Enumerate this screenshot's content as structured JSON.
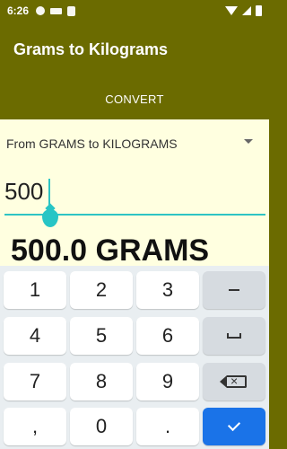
{
  "status_bar": {
    "time": "6:26"
  },
  "app_bar": {
    "title": "Grams to Kilograms"
  },
  "actions": {
    "convert_label": "CONVERT"
  },
  "spinner": {
    "selected": "From GRAMS to KILOGRAMS"
  },
  "input": {
    "value": "500"
  },
  "result": {
    "text": "500.0 GRAMS"
  },
  "keyboard": {
    "rows": [
      [
        "1",
        "2",
        "3",
        "−"
      ],
      [
        "4",
        "5",
        "6",
        "space"
      ],
      [
        "7",
        "8",
        "9",
        "backspace"
      ],
      [
        ",",
        "0",
        ".",
        "enter"
      ]
    ],
    "keys": {
      "k1": "1",
      "k2": "2",
      "k3": "3",
      "k4": "4",
      "k5": "5",
      "k6": "6",
      "k7": "7",
      "k8": "8",
      "k9": "9",
      "comma": ",",
      "zero": "0",
      "dot": "."
    }
  },
  "colors": {
    "primary": "#6b6b00",
    "background": "#ffffe0",
    "accent": "#2ec4c4",
    "enter_key": "#1a73e8"
  }
}
